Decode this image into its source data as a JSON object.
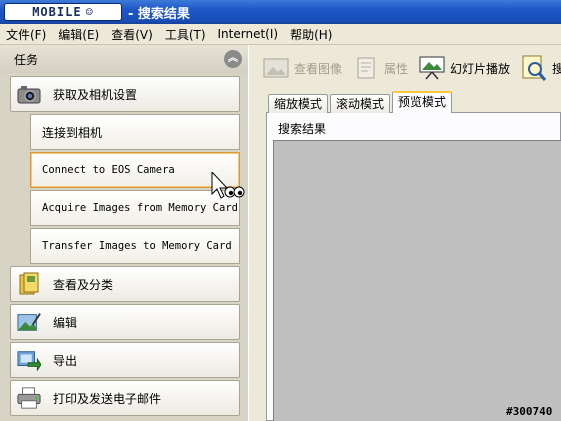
{
  "window": {
    "logo_text": "MOBILE",
    "title": "- 搜索结果"
  },
  "menu": [
    "文件(F)",
    "编辑(E)",
    "查看(V)",
    "工具(T)",
    "Internet(I)",
    "帮助(H)"
  ],
  "task_pane": {
    "header": "任务",
    "collapse_symbol": "︽",
    "sections": {
      "acquire": "获取及相机设置",
      "view": "查看及分类",
      "edit": "编辑",
      "export": "导出",
      "print": "打印及发送电子邮件"
    },
    "sub_items": {
      "connect_camera": "连接到相机",
      "connect_eos": "Connect to EOS Camera",
      "acquire_card": "Acquire Images from Memory Card",
      "transfer_card": "Transfer Images to Memory Card"
    }
  },
  "toolbar": {
    "view_image": "查看图像",
    "properties": "属性",
    "slideshow": "幻灯片播放",
    "search": "搜"
  },
  "tabs": {
    "zoom": "缩放模式",
    "scroll": "滚动模式",
    "preview": "预览模式"
  },
  "results_label": "搜索结果",
  "watermark": "#300740",
  "colors": {
    "titlebar": "#1c56c6",
    "results_bg": "#c0c0c0",
    "active_tab_accent": "#ffc73c",
    "hover_border": "#d69a3c"
  }
}
